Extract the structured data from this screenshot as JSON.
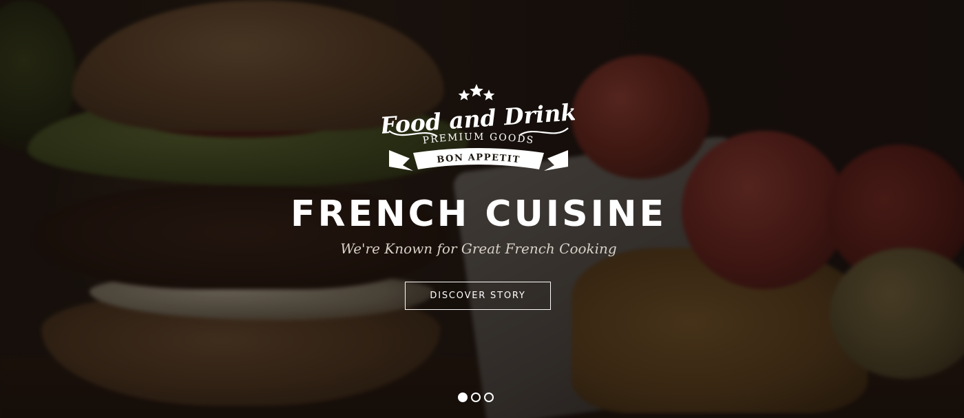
{
  "hero": {
    "logo": {
      "script_text": "Food and Drink",
      "arc_text": "PREMIUM GOODS",
      "ribbon_text": "BON APPETIT",
      "stars": 3
    },
    "headline": "FRENCH CUISINE",
    "tagline": "We're Known for Great French Cooking",
    "cta_label": "DISCOVER STORY"
  },
  "slider": {
    "slide_count": 3,
    "active_index": 0
  },
  "colors": {
    "text": "#ffffff",
    "tagline": "#d8d2c8",
    "overlay": "rgba(14,10,8,0.55)"
  }
}
